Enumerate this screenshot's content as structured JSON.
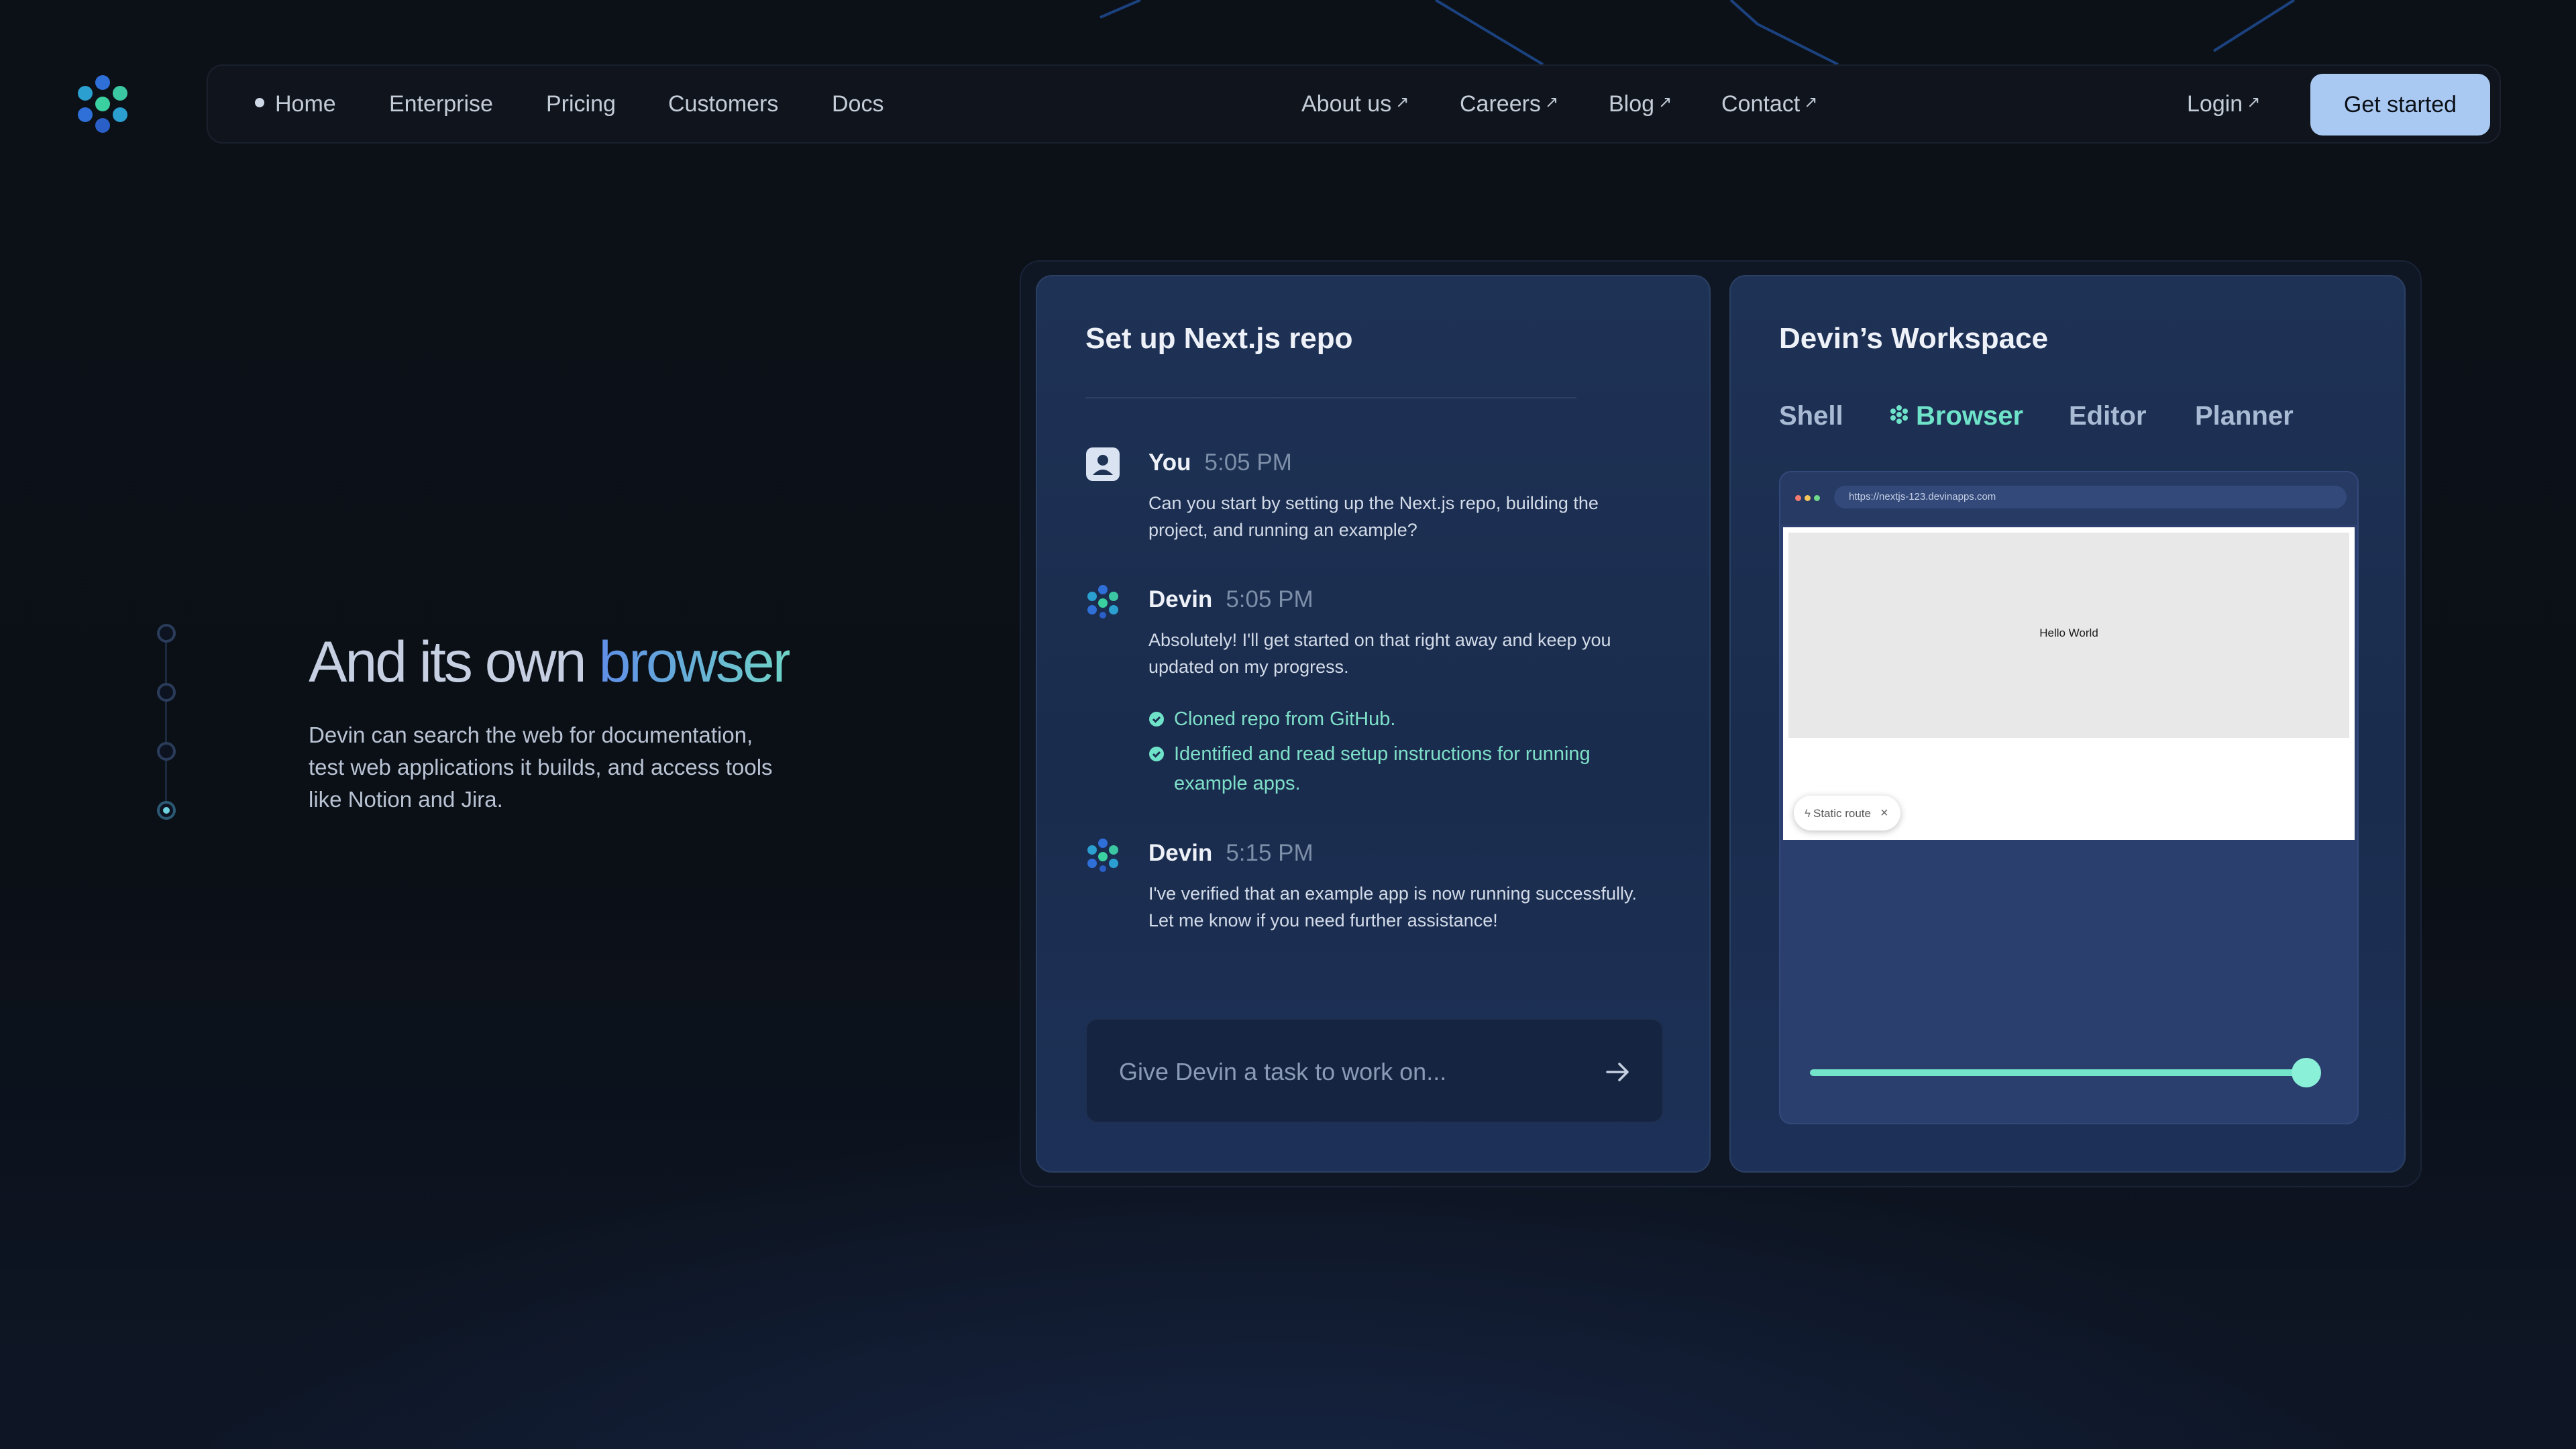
{
  "nav": {
    "left": [
      "Home",
      "Enterprise",
      "Pricing",
      "Customers",
      "Docs"
    ],
    "right": [
      "About us",
      "Careers",
      "Blog",
      "Contact"
    ],
    "login": "Login",
    "cta": "Get started"
  },
  "hero": {
    "title_main": "And its own ",
    "title_highlight": "browser",
    "description": "Devin can search the web for documentation, test web applications it builds, and access tools like Notion and Jira.",
    "steps_total": 4,
    "active_step": 4
  },
  "chat": {
    "title": "Set up Next.js repo",
    "messages": [
      {
        "author": "You",
        "time": "5:05 PM",
        "text": "Can you start by setting up the Next.js repo, building the project, and running an example?"
      },
      {
        "author": "Devin",
        "time": "5:05 PM",
        "text": "Absolutely! I'll get started on that right away and keep you updated on my progress."
      },
      {
        "author": "Devin",
        "time": "5:15 PM",
        "text": "I've verified that an example app is now running successfully. Let me know if you need further assistance!"
      }
    ],
    "checks": [
      "Cloned repo from GitHub.",
      "Identified and read setup instructions for running example apps."
    ],
    "input_placeholder": "Give Devin a task to work on..."
  },
  "workspace": {
    "title": "Devin’s Workspace",
    "tabs": [
      "Shell",
      "Browser",
      "Editor",
      "Planner"
    ],
    "active_tab": "Browser",
    "browser": {
      "url": "https://nextjs-123.devinapps.com",
      "page_text": "Hello World",
      "pill_label": "Static route"
    },
    "slider_value": 1.0
  },
  "colors": {
    "accent_teal": "#6fe3c9",
    "accent_blue": "#5f8ee8",
    "cta_bg": "#a9c8f2",
    "panel_bg": "#1e3256"
  }
}
